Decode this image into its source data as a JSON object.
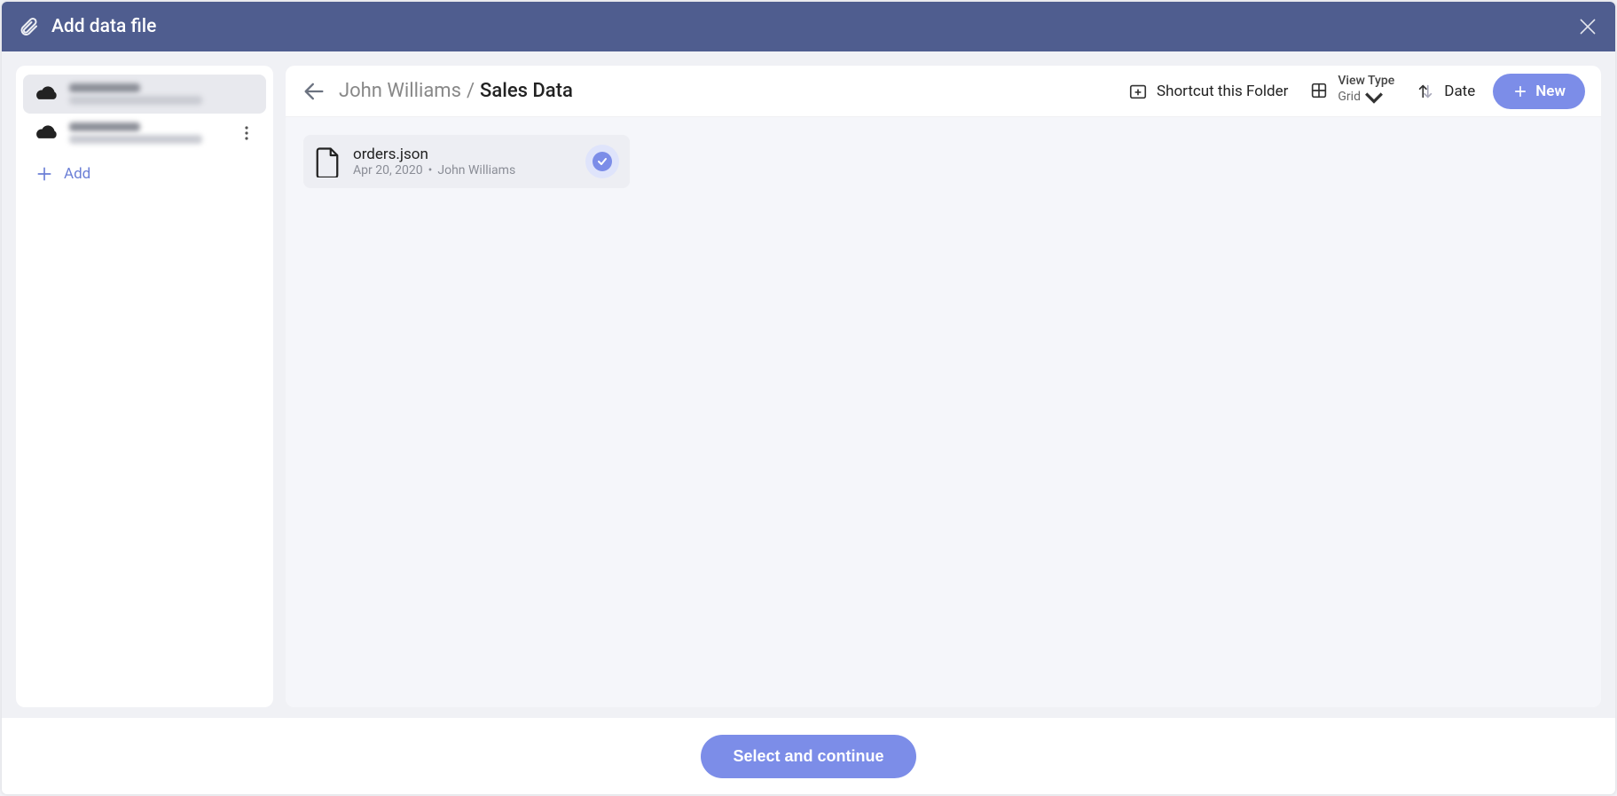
{
  "header": {
    "title": "Add data file"
  },
  "sidebar": {
    "add_label": "Add"
  },
  "toolbar": {
    "breadcrumb": {
      "parent": "John Williams",
      "sep": "/",
      "current": "Sales Data"
    },
    "shortcut_label": "Shortcut this Folder",
    "view_type_label": "View Type",
    "view_type_value": "Grid",
    "sort_label": "Date",
    "new_label": "New"
  },
  "files": [
    {
      "name": "orders.json",
      "date": "Apr 20, 2020",
      "owner": "John Williams",
      "selected": true
    }
  ],
  "footer": {
    "confirm_label": "Select and continue"
  }
}
